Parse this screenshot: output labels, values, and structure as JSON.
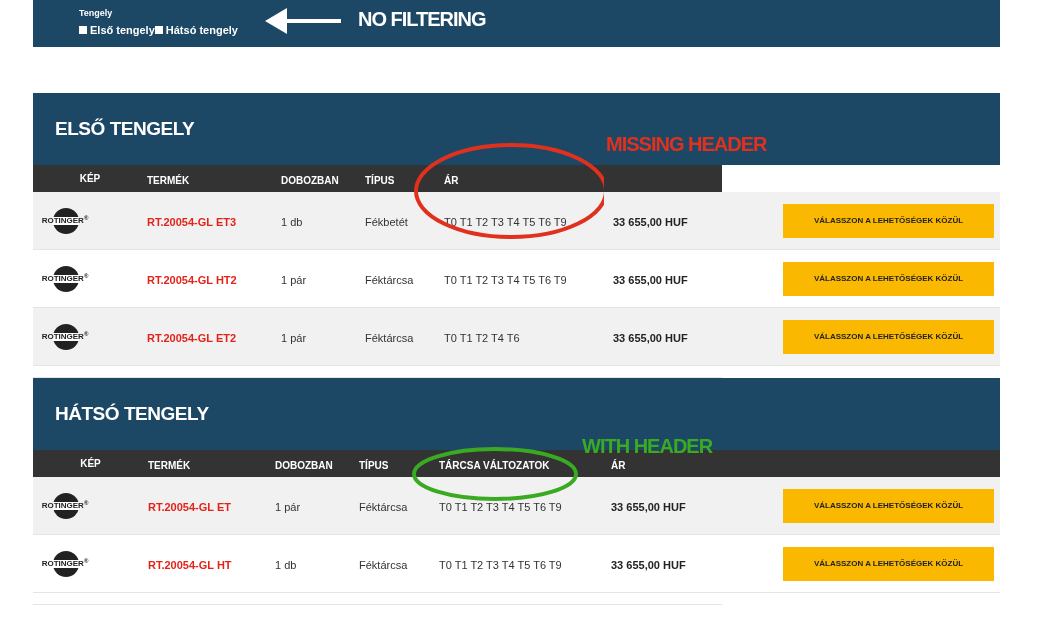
{
  "filter": {
    "label": "Tengely",
    "options": [
      {
        "label": "Első tengely",
        "checked": false
      },
      {
        "label": "Hátsó tengely",
        "checked": false
      }
    ]
  },
  "sections": [
    {
      "title": "ELSŐ TENGELY",
      "columns": [
        "KÉP",
        "TERMÉK",
        "DOBOZBAN",
        "TÍPUS",
        "ÁR"
      ],
      "rows": [
        {
          "logo": "ROTINGER$^{®}$",
          "product": "RT.20054-GL ET3",
          "qty": "1 db",
          "type": "Fékbetét",
          "variants": "T0 T1 T2 T3 T4 T5 T6 T9",
          "price": "33 655,00 HUF",
          "button": "VÁLASSZON A LEHETŐSÉGEK KÖZÜL"
        },
        {
          "logo": "ROTINGER$^{®}$",
          "product": "RT.20054-GL HT2",
          "qty": "1 pár",
          "type": "Féktárcsa",
          "variants": "T0 T1 T2 T3 T4 T5 T6 T9",
          "price": "33 655,00 HUF",
          "button": "VÁLASSZON A LEHETŐSÉGEK KÖZÜL"
        },
        {
          "logo": "ROTINGER$^{®}$",
          "product": "RT.20054-GL ET2",
          "qty": "1 pár",
          "type": "Féktárcsa",
          "variants": "T0 T1 T2 T4 T6",
          "price": "33 655,00 HUF",
          "button": "VÁLASSZON A LEHETŐSÉGEK KÖZÜL"
        }
      ]
    },
    {
      "title": "HÁTSÓ TENGELY",
      "columns": [
        "KÉP",
        "TERMÉK",
        "DOBOZBAN",
        "TÍPUS",
        "TÁRCSA VÁLTOZATOK",
        "ÁR"
      ],
      "rows": [
        {
          "logo": "ROTINGER$^{®}$",
          "product": "RT.20054-GL ET",
          "qty": "1 pár",
          "type": "Féktárcsa",
          "variants": "T0 T1 T2 T3 T4 T5 T6 T9",
          "price": "33 655,00 HUF",
          "button": "VÁLASSZON A LEHETŐSÉGEK KÖZÜL"
        },
        {
          "logo": "ROTINGER$^{®}$",
          "product": "RT.20054-GL HT",
          "qty": "1 db",
          "type": "Féktárcsa",
          "variants": "T0 T1 T2 T3 T4 T5 T6 T9",
          "price": "33 655,00 HUF",
          "button": "VÁLASSZON A LEHETŐSÉGEK KÖZÜL"
        }
      ]
    }
  ],
  "annotations": [
    {
      "text": "NO FILTERING",
      "color": "#ffffff"
    },
    {
      "text": "MISSING HEADER",
      "color": "#e0301e"
    },
    {
      "text": "WITH HEADER",
      "color": "#3aaa22"
    }
  ]
}
